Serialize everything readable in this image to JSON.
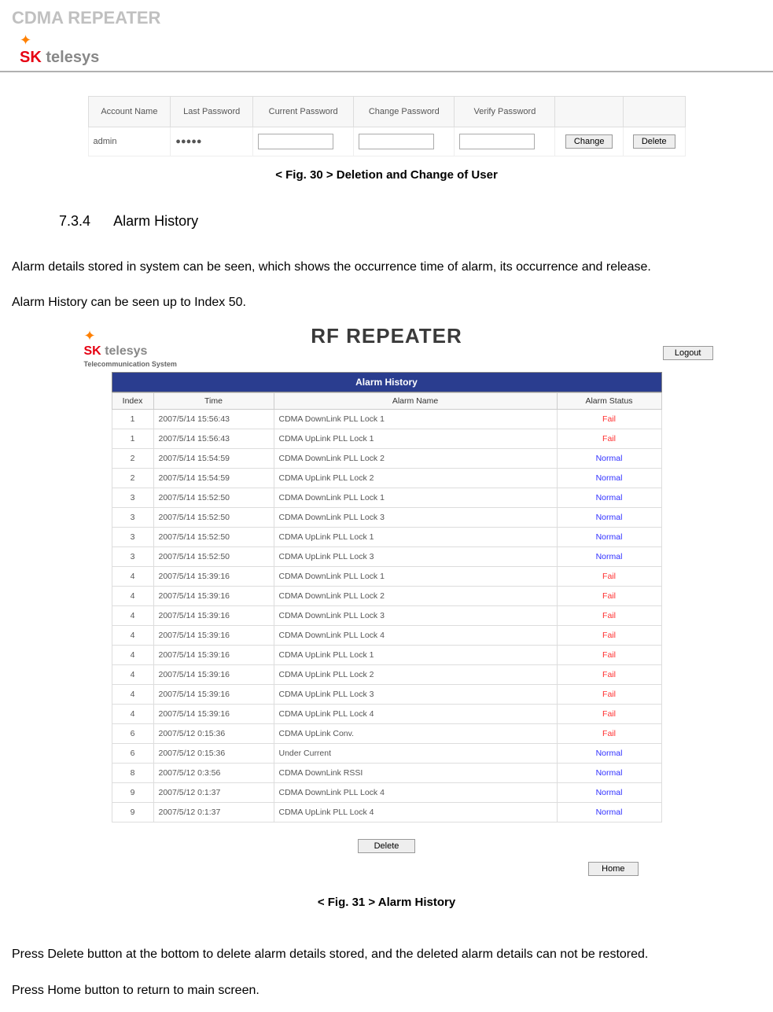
{
  "header": {
    "page_title": "CDMA REPEATER"
  },
  "fig30": {
    "headers": [
      "Account Name",
      "Last Password",
      "Current Password",
      "Change Password",
      "Verify Password"
    ],
    "row": {
      "account": "admin",
      "last_password": "●●●●●"
    },
    "buttons": {
      "change": "Change",
      "delete": "Delete"
    },
    "caption": "< Fig. 30 > Deletion and Change of User"
  },
  "section": {
    "number": "7.3.4",
    "title": "Alarm History"
  },
  "body": {
    "p1": "Alarm details stored in system can be seen, which shows the occurrence time of alarm, its occurrence and release.",
    "p2": "Alarm History can be seen up to Index 50."
  },
  "rf": {
    "title": "RF REPEATER",
    "logo_sub": "Telecommunication System",
    "logout": "Logout",
    "panel_title": "Alarm History",
    "cols": {
      "index": "Index",
      "time": "Time",
      "name": "Alarm Name",
      "status": "Alarm Status"
    },
    "buttons": {
      "delete": "Delete",
      "home": "Home"
    },
    "rows": [
      {
        "index": "1",
        "time": "2007/5/14 15:56:43",
        "name": "CDMA DownLink PLL Lock 1",
        "status": "Fail"
      },
      {
        "index": "1",
        "time": "2007/5/14 15:56:43",
        "name": "CDMA UpLink PLL Lock 1",
        "status": "Fail"
      },
      {
        "index": "2",
        "time": "2007/5/14 15:54:59",
        "name": "CDMA DownLink PLL Lock 2",
        "status": "Normal"
      },
      {
        "index": "2",
        "time": "2007/5/14 15:54:59",
        "name": "CDMA UpLink PLL Lock 2",
        "status": "Normal"
      },
      {
        "index": "3",
        "time": "2007/5/14 15:52:50",
        "name": "CDMA DownLink PLL Lock 1",
        "status": "Normal"
      },
      {
        "index": "3",
        "time": "2007/5/14 15:52:50",
        "name": "CDMA DownLink PLL Lock 3",
        "status": "Normal"
      },
      {
        "index": "3",
        "time": "2007/5/14 15:52:50",
        "name": "CDMA UpLink PLL Lock 1",
        "status": "Normal"
      },
      {
        "index": "3",
        "time": "2007/5/14 15:52:50",
        "name": "CDMA UpLink PLL Lock 3",
        "status": "Normal"
      },
      {
        "index": "4",
        "time": "2007/5/14 15:39:16",
        "name": "CDMA DownLink PLL Lock 1",
        "status": "Fail"
      },
      {
        "index": "4",
        "time": "2007/5/14 15:39:16",
        "name": "CDMA DownLink PLL Lock 2",
        "status": "Fail"
      },
      {
        "index": "4",
        "time": "2007/5/14 15:39:16",
        "name": "CDMA DownLink PLL Lock 3",
        "status": "Fail"
      },
      {
        "index": "4",
        "time": "2007/5/14 15:39:16",
        "name": "CDMA DownLink PLL Lock 4",
        "status": "Fail"
      },
      {
        "index": "4",
        "time": "2007/5/14 15:39:16",
        "name": "CDMA UpLink PLL Lock 1",
        "status": "Fail"
      },
      {
        "index": "4",
        "time": "2007/5/14 15:39:16",
        "name": "CDMA UpLink PLL Lock 2",
        "status": "Fail"
      },
      {
        "index": "4",
        "time": "2007/5/14 15:39:16",
        "name": "CDMA UpLink PLL Lock 3",
        "status": "Fail"
      },
      {
        "index": "4",
        "time": "2007/5/14 15:39:16",
        "name": "CDMA UpLink PLL Lock 4",
        "status": "Fail"
      },
      {
        "index": "6",
        "time": "2007/5/12 0:15:36",
        "name": "CDMA UpLink Conv.",
        "status": "Fail"
      },
      {
        "index": "6",
        "time": "2007/5/12 0:15:36",
        "name": "Under Current",
        "status": "Normal"
      },
      {
        "index": "8",
        "time": "2007/5/12 0:3:56",
        "name": "CDMA DownLink RSSI",
        "status": "Normal"
      },
      {
        "index": "9",
        "time": "2007/5/12 0:1:37",
        "name": "CDMA DownLink PLL Lock 4",
        "status": "Normal"
      },
      {
        "index": "9",
        "time": "2007/5/12 0:1:37",
        "name": "CDMA UpLink PLL Lock 4",
        "status": "Normal"
      }
    ],
    "caption": "< Fig. 31 > Alarm History"
  },
  "body2": {
    "p1": "Press Delete button at the bottom to delete alarm details stored, and the deleted alarm details can not be restored.",
    "p2": "Press Home button to return to main screen."
  }
}
